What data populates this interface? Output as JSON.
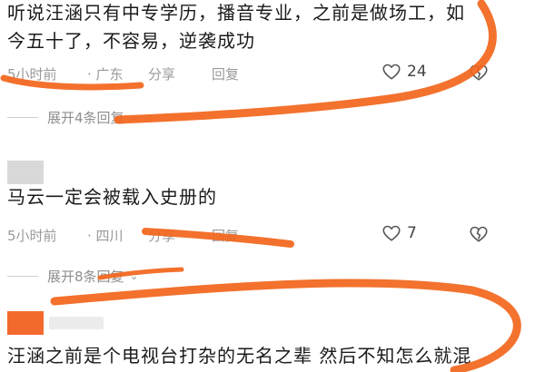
{
  "comments": [
    {
      "text_lines": [
        "听说汪涵只有中专学历，播音专业，之前是做场工，如",
        "今五十了，不容易，逆袭成功"
      ],
      "time": "5小时前",
      "location": "· 广东",
      "share_label": "分享",
      "reply_label": "回复",
      "like_count": "24",
      "expand_label": "展开4条回复"
    },
    {
      "text_lines": [
        "马云一定会被载入史册的"
      ],
      "time": "5小时前",
      "location": "· 四川",
      "share_label": "分享",
      "reply_label": "回复",
      "like_count": "7",
      "expand_label": "展开8条回复"
    },
    {
      "text_lines": [
        "汪涵之前是个电视台打杂的无名之辈 然后不知怎么就混"
      ]
    }
  ],
  "colors": {
    "annotation_orange": "#f2661c",
    "avatar_orange": "#f36a2e"
  },
  "icons": {
    "like": "heart-outline-icon",
    "dislike": "broken-heart-icon",
    "expand": "chevron-down-icon"
  }
}
